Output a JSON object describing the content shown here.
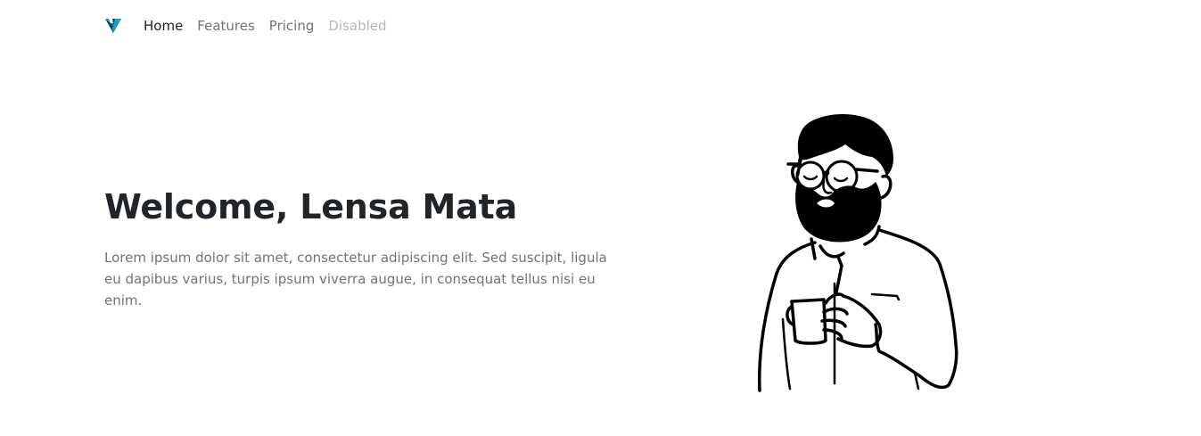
{
  "navbar": {
    "logo_icon": "v-logo-icon",
    "logo_colors": [
      "#12a1c9",
      "#1a3a5c"
    ],
    "links": [
      {
        "label": "Home",
        "state": "active"
      },
      {
        "label": "Features",
        "state": "normal"
      },
      {
        "label": "Pricing",
        "state": "normal"
      },
      {
        "label": "Disabled",
        "state": "disabled"
      }
    ]
  },
  "hero": {
    "title": "Welcome, Lensa Mata",
    "text": "Lorem ipsum dolor sit amet, consectetur adipiscing elit. Sed suscipit, ligula eu dapibus varius, turpis ipsum viverra augue, in consequat tellus nisi eu enim.",
    "illustration_icon": "bearded-man-with-cup-illustration"
  }
}
